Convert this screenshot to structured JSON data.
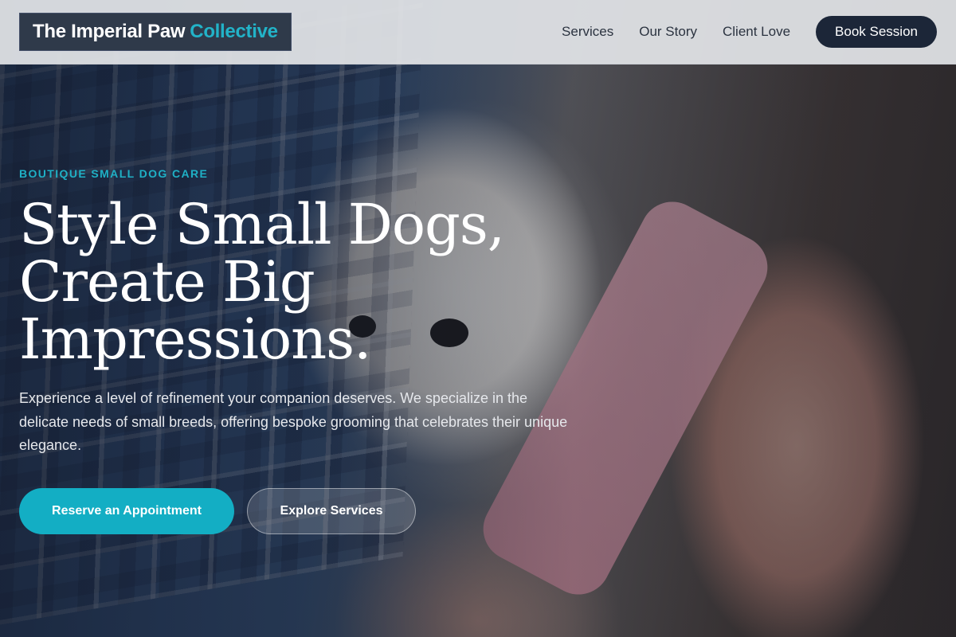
{
  "brand": {
    "name_main": "The Imperial Paw",
    "name_accent": "Collective",
    "accent_color": "#22b3c8"
  },
  "nav": {
    "items": [
      {
        "label": "Services"
      },
      {
        "label": "Our Story"
      },
      {
        "label": "Client Love"
      }
    ],
    "cta_label": "Book Session"
  },
  "hero": {
    "eyebrow": "BOUTIQUE SMALL DOG CARE",
    "headline": "Style Small Dogs, Create Big Impressions.",
    "lead": "Experience a level of refinement your companion deserves. We specialize in the delicate needs of small breeds, offering bespoke grooming that celebrates their unique elegance.",
    "primary_button": "Reserve an Appointment",
    "secondary_button": "Explore Services"
  },
  "colors": {
    "primary": "#13aec4",
    "dark": "#1c2638"
  }
}
